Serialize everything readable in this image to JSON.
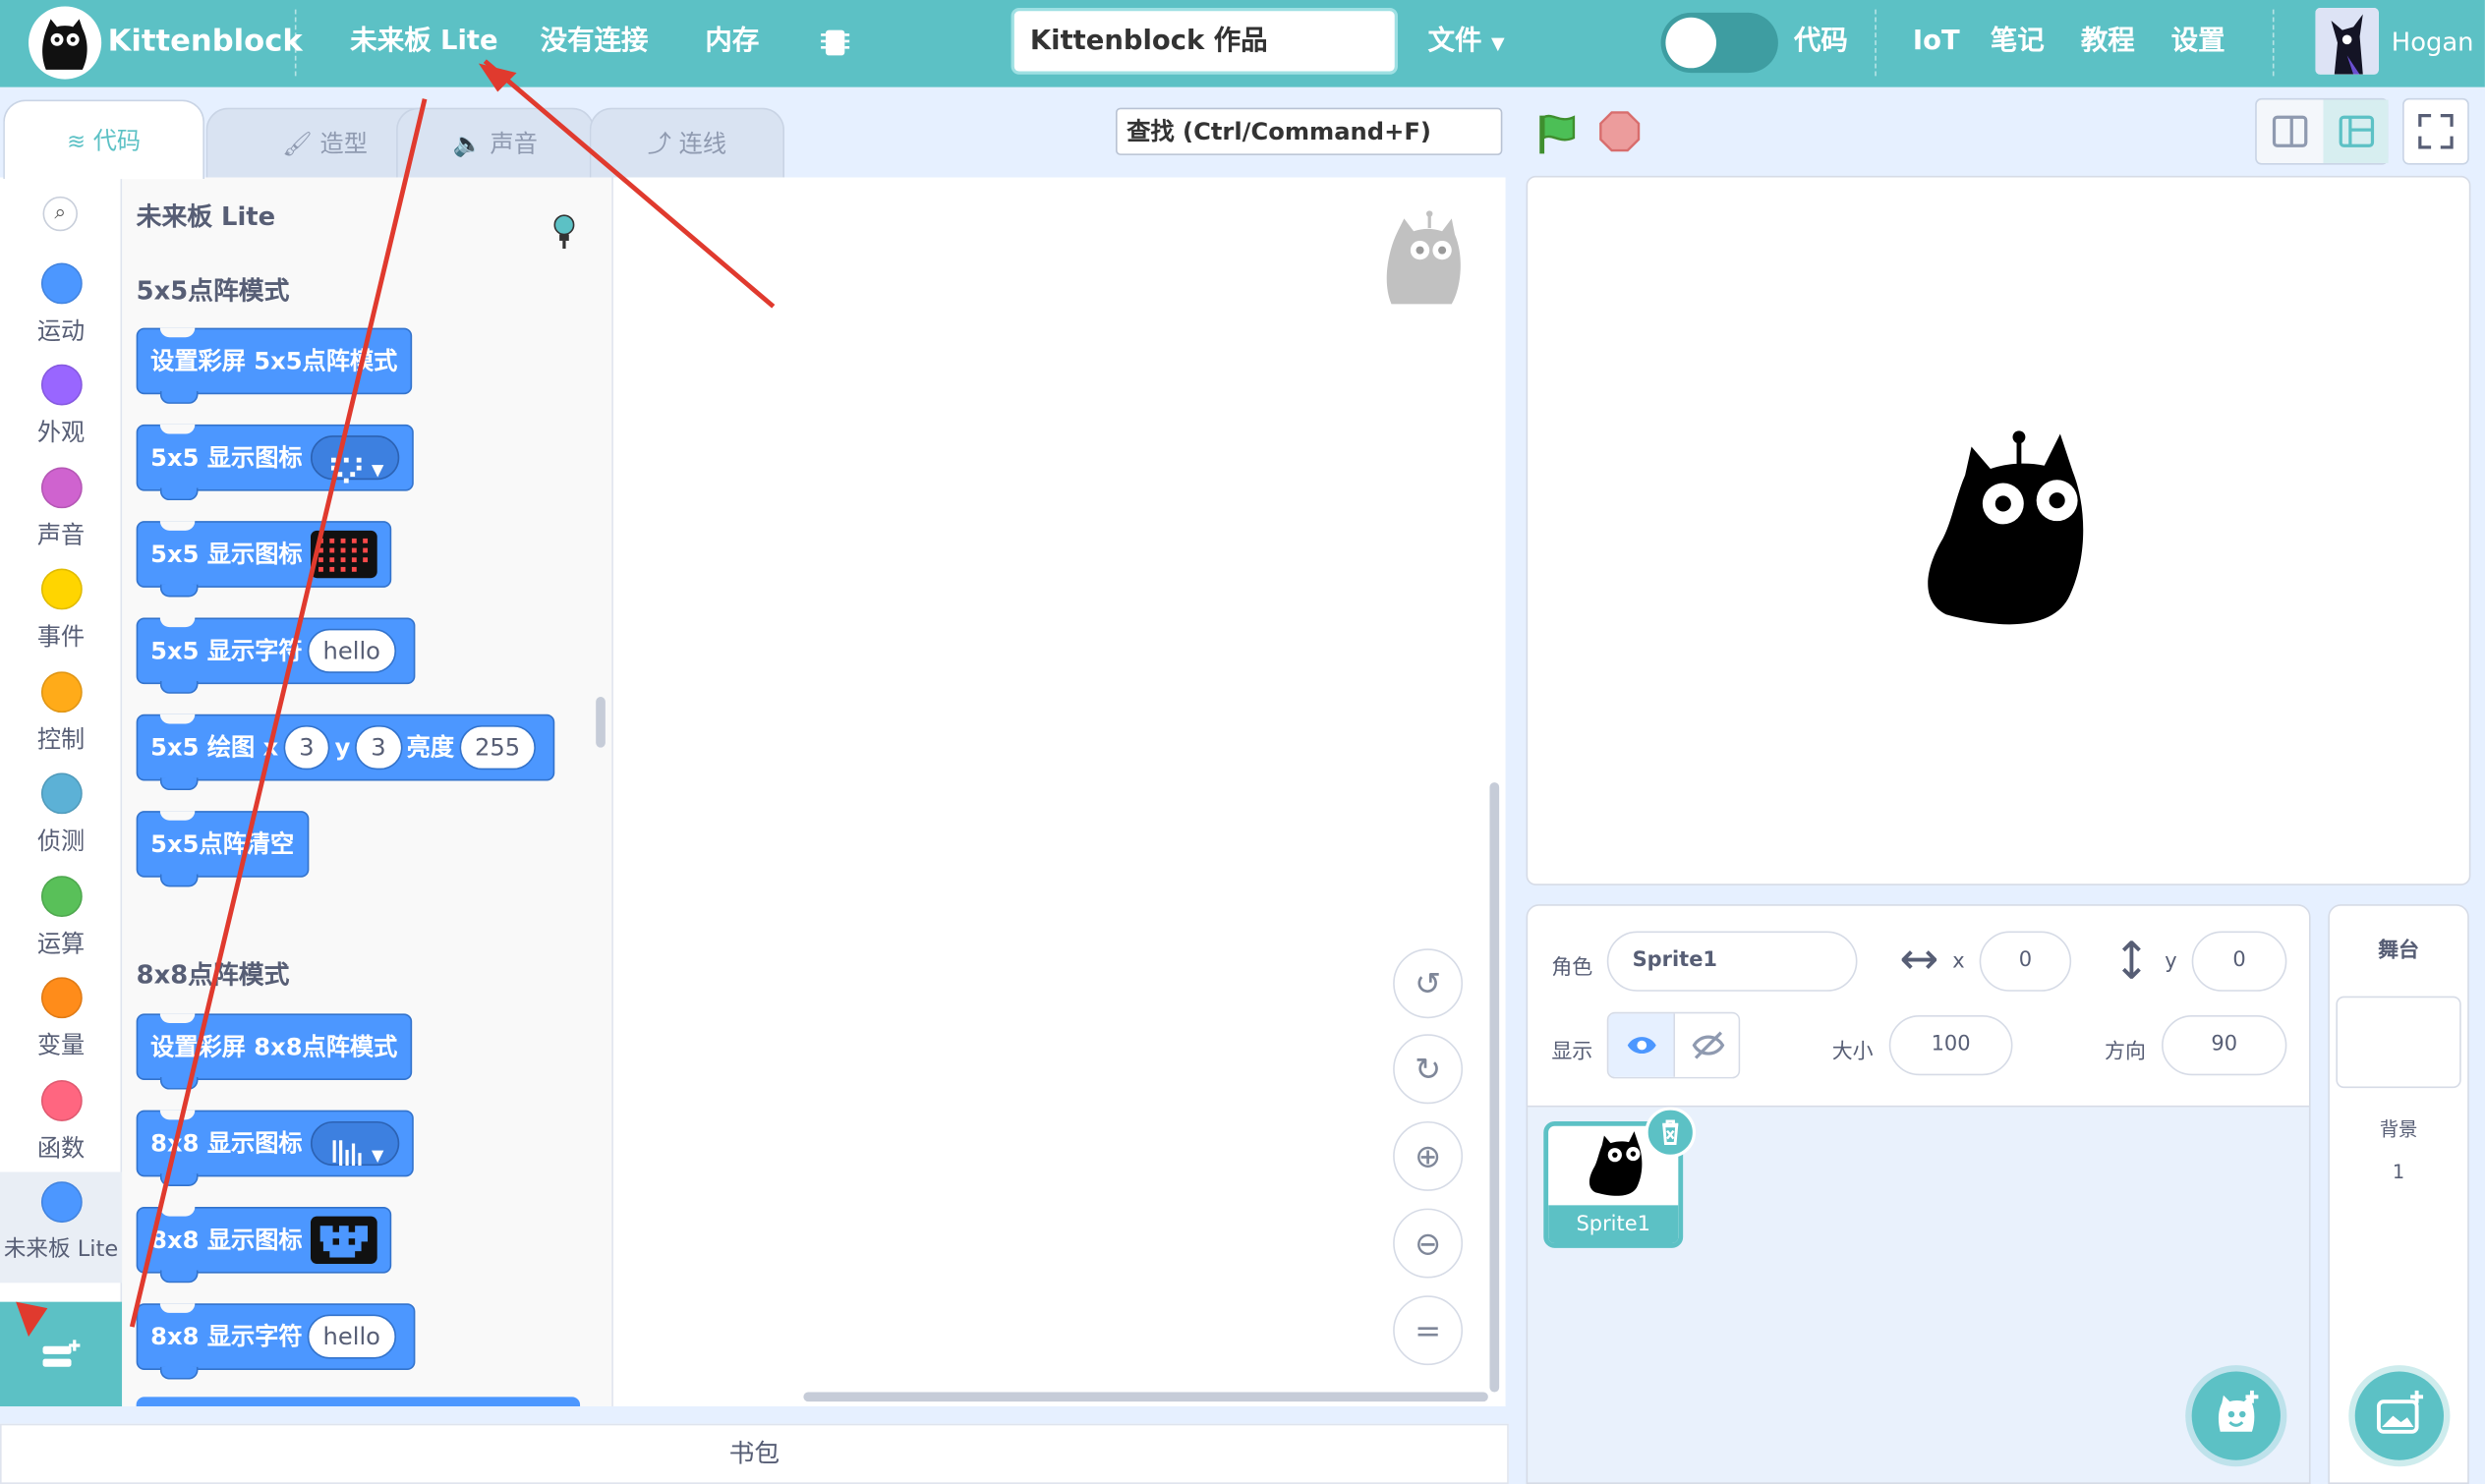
{
  "topbar": {
    "app_name": "Kittenblock",
    "board_menu": "未来板 Lite",
    "connection_menu": "没有连接",
    "memory_menu": "内存",
    "project_title": "Kittenblock 作品",
    "file_menu": "文件",
    "code_label": "代码",
    "iot_menu": "IoT",
    "notes_menu": "笔记",
    "tutorial_menu": "教程",
    "settings_menu": "设置",
    "user_name": "Hogan"
  },
  "tabs": [
    {
      "label": "代码",
      "active": true
    },
    {
      "label": "造型",
      "active": false
    },
    {
      "label": "声音",
      "active": false
    },
    {
      "label": "连线",
      "active": false
    }
  ],
  "categories": [
    {
      "label": "运动",
      "color": "#4c97ff"
    },
    {
      "label": "外观",
      "color": "#9966ff"
    },
    {
      "label": "声音",
      "color": "#cf63cf"
    },
    {
      "label": "事件",
      "color": "#ffd500"
    },
    {
      "label": "控制",
      "color": "#ffab19"
    },
    {
      "label": "侦测",
      "color": "#5cb1d6"
    },
    {
      "label": "运算",
      "color": "#59c059"
    },
    {
      "label": "变量",
      "color": "#ff8c1a"
    },
    {
      "label": "函数",
      "color": "#ff6680"
    },
    {
      "label": "未来板 Lite",
      "color": "#4c97ff"
    }
  ],
  "palette": {
    "extension_title": "未来板 Lite",
    "section_5x5": "5x5点阵模式",
    "section_8x8": "8x8点阵模式",
    "blocks_5x5": {
      "set_mode": "设置彩屏 5x5点阵模式",
      "show_icon_menu": "5x5 显示图标",
      "show_icon_matrix": "5x5 显示图标",
      "show_text": "5x5 显示字符",
      "show_text_value": "hello",
      "draw_prefix": "5x5 绘图",
      "draw_x_label": "x",
      "draw_x_value": "3",
      "draw_y_label": "y",
      "draw_y_value": "3",
      "draw_brightness_label": "亮度",
      "draw_brightness_value": "255",
      "clear": "5x5点阵清空"
    },
    "blocks_8x8": {
      "set_mode": "设置彩屏 8x8点阵模式",
      "show_icon_menu": "8x8 显示图标",
      "show_icon_matrix": "8x8 显示图标",
      "show_text": "8x8 显示字符",
      "show_text_value": "hello"
    }
  },
  "search": {
    "placeholder": "查找 (Ctrl/Command+F)"
  },
  "backpack": {
    "label": "书包"
  },
  "sprite_info": {
    "sprite_label": "角色",
    "sprite_name": "Sprite1",
    "x_label": "x",
    "x_value": "0",
    "y_label": "y",
    "y_value": "0",
    "show_label": "显示",
    "size_label": "大小",
    "size_value": "100",
    "direction_label": "方向",
    "direction_value": "90"
  },
  "sprite_list": [
    {
      "name": "Sprite1",
      "selected": true
    }
  ],
  "stage_panel": {
    "title": "舞台",
    "backdrop_label": "背景",
    "backdrop_count": "1"
  },
  "colors": {
    "accent": "#5cc1c5",
    "block_blue": "#4c97ff",
    "annotation_red": "#e03a2e"
  }
}
